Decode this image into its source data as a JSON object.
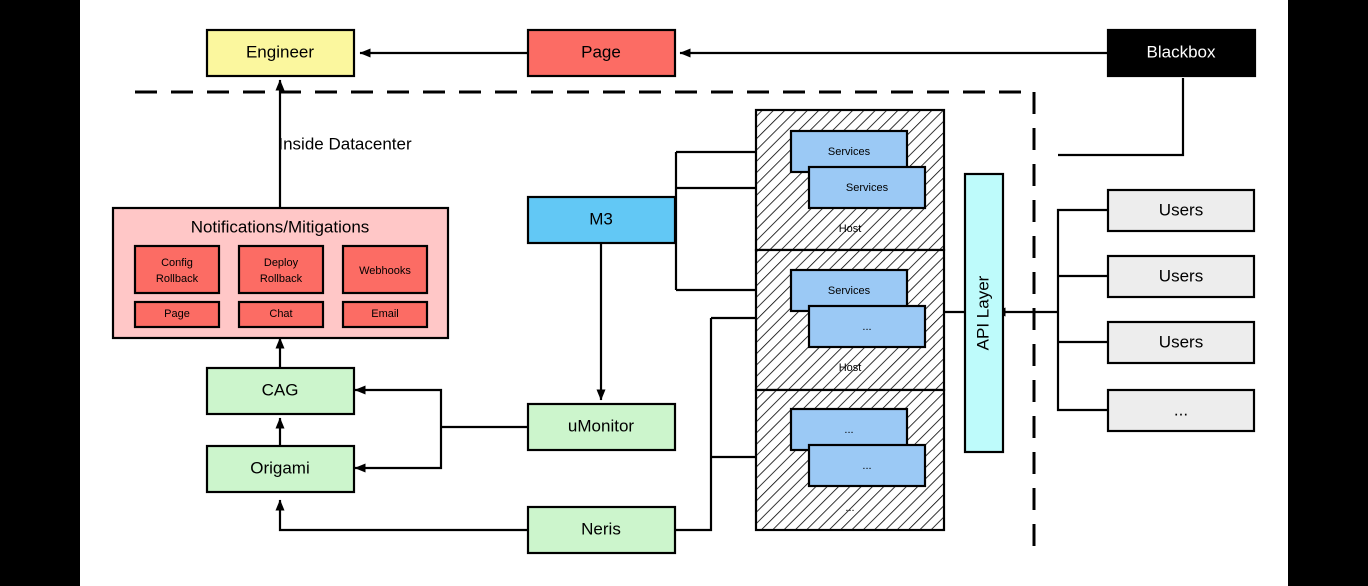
{
  "diagram": {
    "title": "Inside Datacenter",
    "boundary_label": "Inside Datacenter",
    "colors": {
      "engineer": "#FBF79E",
      "page": "#FC6C64",
      "blackbox": "#000000",
      "blackbox_text": "#FFFFFF",
      "notifications_panel": "#FFC7C7",
      "notification_item": "#FC6C64",
      "m3": "#62C8F5",
      "service": "#9BC9F5",
      "api_layer": "#BEFBFB",
      "green": "#CCF5CC",
      "users": "#EDEDED",
      "host_fill": "#FFFFFF",
      "stroke": "#000000"
    },
    "nodes": {
      "engineer": "Engineer",
      "page": "Page",
      "blackbox": "Blackbox",
      "m3": "M3",
      "umonitor": "uMonitor",
      "neris": "Neris",
      "cag": "CAG",
      "origami": "Origami",
      "api_layer": "API Layer"
    },
    "notifications": {
      "title": "Notifications/Mitigations",
      "items": [
        "Config\nRollback",
        "Deploy\nRollback",
        "Webhooks",
        "Page",
        "Chat",
        "Email"
      ],
      "items_row1": [
        "Config",
        "Rollback",
        "Deploy",
        "Rollback",
        "Webhooks"
      ],
      "items_row2": [
        "Page",
        "Chat",
        "Email"
      ]
    },
    "hosts": [
      {
        "label": "Host",
        "services": [
          "Services",
          "Services"
        ]
      },
      {
        "label": "Host",
        "services": [
          "Services",
          "..."
        ]
      },
      {
        "label": "...",
        "services": [
          "...",
          "..."
        ]
      }
    ],
    "users": [
      "Users",
      "Users",
      "Users",
      "..."
    ]
  }
}
